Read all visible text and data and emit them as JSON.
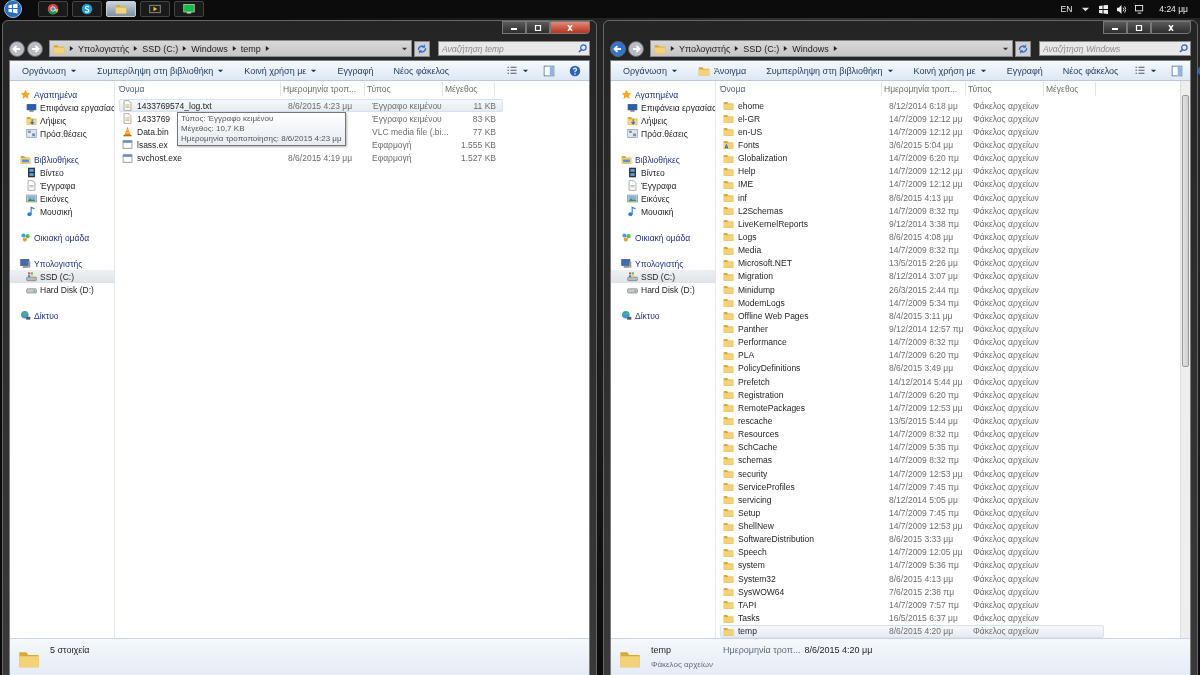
{
  "taskbar": {
    "apps": [
      {
        "kind": "browser",
        "selected": false
      },
      {
        "kind": "chat",
        "selected": false
      },
      {
        "kind": "explorer",
        "selected": true
      },
      {
        "kind": "media",
        "selected": false
      },
      {
        "kind": "monitor",
        "selected": false
      }
    ],
    "language": "EN",
    "time": "4:24 μμ"
  },
  "windows": [
    {
      "active": true,
      "back_enabled": false,
      "crumbs": [
        "Υπολογιστής",
        "SSD (C:)",
        "Windows",
        "temp"
      ],
      "search": {
        "placeholder": "Αναζήτηση temp"
      },
      "toolbar": [
        {
          "label": "Οργάνωση",
          "kind": "menu"
        },
        {
          "label": "Συμπερίληψη στη βιβλιοθήκη",
          "kind": "menu"
        },
        {
          "label": "Κοινή χρήση με",
          "kind": "menu"
        },
        {
          "label": "Εγγραφή",
          "kind": "button"
        },
        {
          "label": "Νέος φάκελος",
          "kind": "button"
        }
      ],
      "nav": [
        {
          "label": "Αγαπημένα",
          "kind": "star",
          "selected": false,
          "children": [
            {
              "label": "Επιφάνεια εργασίας",
              "kind": "desktop",
              "selected": false
            },
            {
              "label": "Λήψεις",
              "kind": "download",
              "selected": false
            },
            {
              "label": "Πρόσ.θέσεις",
              "kind": "places",
              "selected": false
            }
          ]
        },
        {
          "label": "Βιβλιοθήκες",
          "kind": "library",
          "selected": false,
          "children": [
            {
              "label": "Βίντεο",
              "kind": "video",
              "selected": false
            },
            {
              "label": "Έγγραφα",
              "kind": "documents",
              "selected": false
            },
            {
              "label": "Εικόνες",
              "kind": "pictures",
              "selected": false
            },
            {
              "label": "Μουσική",
              "kind": "music",
              "selected": false
            }
          ]
        },
        {
          "label": "Οικιακή ομάδα",
          "kind": "homegroup",
          "selected": false
        },
        {
          "label": "Υπολογιστής",
          "kind": "computer",
          "selected": false,
          "children": [
            {
              "label": "SSD (C:)",
              "kind": "system-drive",
              "selected": true
            },
            {
              "label": "Hard Disk (D:)",
              "kind": "drive",
              "selected": false
            }
          ]
        },
        {
          "label": "Δίκτυο",
          "kind": "network",
          "selected": false
        }
      ],
      "columns": [
        "Όνομα",
        "Ημερομηνία τροπ...",
        "Τύπος",
        "Μέγεθος"
      ],
      "rows": [
        {
          "kind": "text",
          "name": "1433769574_log.txt",
          "date": "8/6/2015 4:23 μμ",
          "type": "Έγγραφο κειμένου",
          "size": "11 KB",
          "selected": true
        },
        {
          "kind": "text",
          "name": "1433769",
          "type": "Έγγραφο κειμένου",
          "size": "83 KB",
          "selected": false
        },
        {
          "kind": "vlc",
          "name": "Data.bin",
          "type": "VLC media file (.bi...",
          "size": "77 KB",
          "selected": false
        },
        {
          "kind": "app",
          "name": "lsass.ex",
          "type": "Εφαρμογή",
          "size": "1.555 KB",
          "selected": false
        },
        {
          "kind": "app",
          "name": "svchost.exe",
          "date": "8/6/2015 4:19 μμ",
          "type": "Εφαρμογή",
          "size": "1.527 KB",
          "selected": false
        }
      ],
      "tooltip": [
        "Τύπος: Έγγραφο κειμένου",
        "Μέγεθος: 10,7 KB",
        "Ημερομηνία τροποποίησης: 8/6/2015 4:23 μμ"
      ],
      "scrollbar": false,
      "details": {
        "kind": "count",
        "text": "5 στοιχεία"
      }
    },
    {
      "active": false,
      "back_enabled": true,
      "crumbs": [
        "Υπολογιστής",
        "SSD (C:)",
        "Windows"
      ],
      "search": {
        "placeholder": "Αναζήτηση Windows"
      },
      "toolbar": [
        {
          "label": "Οργάνωση",
          "kind": "menu"
        },
        {
          "label": "Άνοιγμα",
          "kind": "open"
        },
        {
          "label": "Συμπερίληψη στη βιβλιοθήκη",
          "kind": "menu"
        },
        {
          "label": "Κοινή χρήση με",
          "kind": "menu"
        },
        {
          "label": "Εγγραφή",
          "kind": "button"
        },
        {
          "label": "Νέος φάκελος",
          "kind": "button"
        }
      ],
      "nav": [
        {
          "label": "Αγαπημένα",
          "kind": "star",
          "selected": false,
          "children": [
            {
              "label": "Επιφάνεια εργασίας",
              "kind": "desktop",
              "selected": false
            },
            {
              "label": "Λήψεις",
              "kind": "download",
              "selected": false
            },
            {
              "label": "Πρόσ.θέσεις",
              "kind": "places",
              "selected": false
            }
          ]
        },
        {
          "label": "Βιβλιοθήκες",
          "kind": "library",
          "selected": false,
          "children": [
            {
              "label": "Βίντεο",
              "kind": "video",
              "selected": false
            },
            {
              "label": "Έγγραφα",
              "kind": "documents",
              "selected": false
            },
            {
              "label": "Εικόνες",
              "kind": "pictures",
              "selected": false
            },
            {
              "label": "Μουσική",
              "kind": "music",
              "selected": false
            }
          ]
        },
        {
          "label": "Οικιακή ομάδα",
          "kind": "homegroup",
          "selected": false
        },
        {
          "label": "Υπολογιστής",
          "kind": "computer",
          "selected": false,
          "children": [
            {
              "label": "SSD (C:)",
              "kind": "system-drive",
              "selected": true
            },
            {
              "label": "Hard Disk (D:)",
              "kind": "drive",
              "selected": false
            }
          ]
        },
        {
          "label": "Δίκτυο",
          "kind": "network",
          "selected": false
        }
      ],
      "columns": [
        "Όνομα",
        "Ημερομηνία τροπ...",
        "Τύπος",
        "Μέγεθος"
      ],
      "rows": [
        {
          "kind": "folder",
          "name": "ehome",
          "date": "8/12/2014 6:18 μμ",
          "type": "Φάκελος αρχείων",
          "selected": false
        },
        {
          "kind": "folder",
          "name": "el-GR",
          "date": "14/7/2009 12:12 μμ",
          "type": "Φάκελος αρχείων",
          "selected": false
        },
        {
          "kind": "folder",
          "name": "en-US",
          "date": "14/7/2009 12:12 μμ",
          "type": "Φάκελος αρχείων",
          "selected": false
        },
        {
          "kind": "font-folder",
          "name": "Fonts",
          "date": "3/6/2015 5:04 μμ",
          "type": "Φάκελος αρχείων",
          "selected": false
        },
        {
          "kind": "folder",
          "name": "Globalization",
          "date": "14/7/2009 6:20 πμ",
          "type": "Φάκελος αρχείων",
          "selected": false
        },
        {
          "kind": "folder",
          "name": "Help",
          "date": "14/7/2009 12:12 μμ",
          "type": "Φάκελος αρχείων",
          "selected": false
        },
        {
          "kind": "folder",
          "name": "IME",
          "date": "14/7/2009 12:12 μμ",
          "type": "Φάκελος αρχείων",
          "selected": false
        },
        {
          "kind": "folder",
          "name": "inf",
          "date": "8/6/2015 4:13 μμ",
          "type": "Φάκελος αρχείων",
          "selected": false
        },
        {
          "kind": "folder",
          "name": "L2Schemas",
          "date": "14/7/2009 8:32 πμ",
          "type": "Φάκελος αρχείων",
          "selected": false
        },
        {
          "kind": "folder",
          "name": "LiveKernelReports",
          "date": "9/12/2014 3:38 πμ",
          "type": "Φάκελος αρχείων",
          "selected": false
        },
        {
          "kind": "folder",
          "name": "Logs",
          "date": "8/6/2015 4:08 μμ",
          "type": "Φάκελος αρχείων",
          "selected": false
        },
        {
          "kind": "folder",
          "name": "Media",
          "date": "14/7/2009 8:32 πμ",
          "type": "Φάκελος αρχείων",
          "selected": false
        },
        {
          "kind": "folder",
          "name": "Microsoft.NET",
          "date": "13/5/2015 2:26 μμ",
          "type": "Φάκελος αρχείων",
          "selected": false
        },
        {
          "kind": "folder",
          "name": "Migration",
          "date": "8/12/2014 3:07 μμ",
          "type": "Φάκελος αρχείων",
          "selected": false
        },
        {
          "kind": "folder",
          "name": "Minidump",
          "date": "26/3/2015 2:44 πμ",
          "type": "Φάκελος αρχείων",
          "selected": false
        },
        {
          "kind": "folder",
          "name": "ModemLogs",
          "date": "14/7/2009 5:34 πμ",
          "type": "Φάκελος αρχείων",
          "selected": false
        },
        {
          "kind": "folder",
          "name": "Offline Web Pages",
          "date": "8/4/2015 3:11 μμ",
          "type": "Φάκελος αρχείων",
          "selected": false
        },
        {
          "kind": "folder",
          "name": "Panther",
          "date": "9/12/2014 12:57 πμ",
          "type": "Φάκελος αρχείων",
          "selected": false
        },
        {
          "kind": "folder",
          "name": "Performance",
          "date": "14/7/2009 8:32 πμ",
          "type": "Φάκελος αρχείων",
          "selected": false
        },
        {
          "kind": "folder",
          "name": "PLA",
          "date": "14/7/2009 6:20 πμ",
          "type": "Φάκελος αρχείων",
          "selected": false
        },
        {
          "kind": "folder",
          "name": "PolicyDefinitions",
          "date": "8/6/2015 3:49 μμ",
          "type": "Φάκελος αρχείων",
          "selected": false
        },
        {
          "kind": "folder",
          "name": "Prefetch",
          "date": "14/12/2014 5:44 μμ",
          "type": "Φάκελος αρχείων",
          "selected": false
        },
        {
          "kind": "folder",
          "name": "Registration",
          "date": "14/7/2009 6:20 πμ",
          "type": "Φάκελος αρχείων",
          "selected": false
        },
        {
          "kind": "folder",
          "name": "RemotePackages",
          "date": "14/7/2009 12:53 μμ",
          "type": "Φάκελος αρχείων",
          "selected": false
        },
        {
          "kind": "folder",
          "name": "rescache",
          "date": "13/5/2015 5:44 μμ",
          "type": "Φάκελος αρχείων",
          "selected": false
        },
        {
          "kind": "folder",
          "name": "Resources",
          "date": "14/7/2009 8:32 πμ",
          "type": "Φάκελος αρχείων",
          "selected": false
        },
        {
          "kind": "folder",
          "name": "SchCache",
          "date": "14/7/2009 5:35 πμ",
          "type": "Φάκελος αρχείων",
          "selected": false
        },
        {
          "kind": "folder",
          "name": "schemas",
          "date": "14/7/2009 8:32 πμ",
          "type": "Φάκελος αρχείων",
          "selected": false
        },
        {
          "kind": "folder",
          "name": "security",
          "date": "14/7/2009 12:53 μμ",
          "type": "Φάκελος αρχείων",
          "selected": false
        },
        {
          "kind": "folder",
          "name": "ServiceProfiles",
          "date": "14/7/2009 7:45 πμ",
          "type": "Φάκελος αρχείων",
          "selected": false
        },
        {
          "kind": "folder",
          "name": "servicing",
          "date": "8/12/2014 5:05 μμ",
          "type": "Φάκελος αρχείων",
          "selected": false
        },
        {
          "kind": "folder",
          "name": "Setup",
          "date": "14/7/2009 7:45 πμ",
          "type": "Φάκελος αρχείων",
          "selected": false
        },
        {
          "kind": "folder",
          "name": "ShellNew",
          "date": "14/7/2009 12:53 μμ",
          "type": "Φάκελος αρχείων",
          "selected": false
        },
        {
          "kind": "folder",
          "name": "SoftwareDistribution",
          "date": "8/6/2015 3:33 μμ",
          "type": "Φάκελος αρχείων",
          "selected": false
        },
        {
          "kind": "folder",
          "name": "Speech",
          "date": "14/7/2009 12:05 μμ",
          "type": "Φάκελος αρχείων",
          "selected": false
        },
        {
          "kind": "folder",
          "name": "system",
          "date": "14/7/2009 5:36 πμ",
          "type": "Φάκελος αρχείων",
          "selected": false
        },
        {
          "kind": "folder",
          "name": "System32",
          "date": "8/6/2015 4:13 μμ",
          "type": "Φάκελος αρχείων",
          "selected": false
        },
        {
          "kind": "folder",
          "name": "SysWOW64",
          "date": "7/6/2015 2:38 πμ",
          "type": "Φάκελος αρχείων",
          "selected": false
        },
        {
          "kind": "folder",
          "name": "TAPI",
          "date": "14/7/2009 7:57 πμ",
          "type": "Φάκελος αρχείων",
          "selected": false
        },
        {
          "kind": "folder",
          "name": "Tasks",
          "date": "16/5/2015 6:37 μμ",
          "type": "Φάκελος αρχείων",
          "selected": false
        },
        {
          "kind": "folder",
          "name": "temp",
          "date": "8/6/2015 4:20 μμ",
          "type": "Φάκελος αρχείων",
          "selected": true
        }
      ],
      "scrollbar": true,
      "details": {
        "kind": "item",
        "name": "temp",
        "type": "Φάκελος αρχείων",
        "label": "Ημερομηνία τροπ...",
        "value": "8/6/2015 4:20 μμ"
      }
    }
  ]
}
